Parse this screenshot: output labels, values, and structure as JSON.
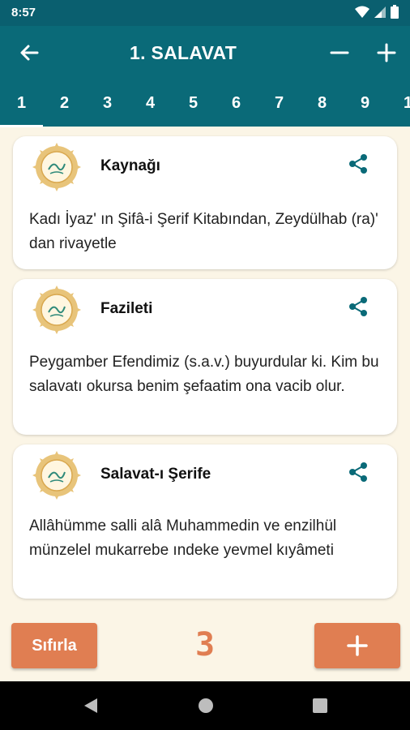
{
  "status": {
    "time": "8:57"
  },
  "appbar": {
    "title": "1. SALAVAT"
  },
  "tabs": [
    "1",
    "2",
    "3",
    "4",
    "5",
    "6",
    "7",
    "8",
    "9",
    "1"
  ],
  "cards": [
    {
      "title": "Kaynağı",
      "text": "Kadı İyaz' ın Şifâ-i Şerif Kitabından, Zeydülhab (ra)' dan rivayetle"
    },
    {
      "title": "Fazileti",
      "text": "Peygamber Efendimiz (s.a.v.) buyurdular ki. Kim bu salavatı okursa benim şefaatim ona vacib olur."
    },
    {
      "title": "Salavat-ı Şerife",
      "text": "Allâhümme salli alâ Muhammedin ve enzilhül münzelel mukarrebe ındeke yevmel kıyâmeti"
    }
  ],
  "bottom": {
    "reset_label": "Sıfırla",
    "counter": "3"
  },
  "icons": {
    "back": "arrow-left-icon",
    "minus": "minus-icon",
    "plus": "plus-icon",
    "share": "share-icon",
    "medallion": "calligraphy-medallion-icon",
    "add": "plus-icon",
    "nav_back": "nav-back-icon",
    "nav_home": "nav-home-icon",
    "nav_recents": "nav-recents-icon"
  },
  "colors": {
    "primary": "#0a6a78",
    "accent": "#e07e52",
    "background": "#fbf5e6"
  }
}
